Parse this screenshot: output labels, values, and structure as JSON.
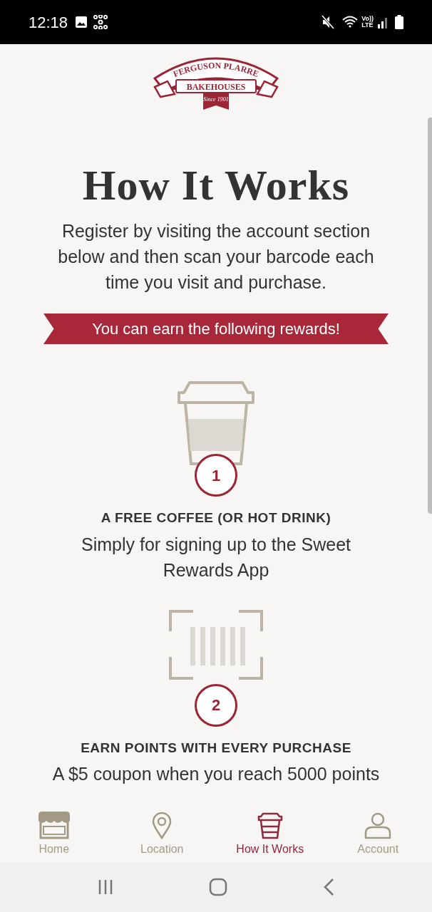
{
  "status_bar": {
    "time": "12:18",
    "volte": "Vo))",
    "network_type": "LTE"
  },
  "logo": {
    "top": "FERGUSON PLARRE",
    "middle": "BAKEHOUSES",
    "bottom": "Since 1901"
  },
  "title": "How It Works",
  "intro": "Register by visiting the account section below and then scan your barcode each time you visit and purchase.",
  "banner": "You can earn the following rewards!",
  "rewards": [
    {
      "kind": "cup",
      "number": "1",
      "heading": "A FREE COFFEE (OR HOT DRINK)",
      "text": "Simply for signing up to the Sweet Rewards App"
    },
    {
      "kind": "barcode",
      "number": "2",
      "heading": "EARN POINTS WITH EVERY PURCHASE",
      "text": "A $5 coupon when you reach 5000 points"
    }
  ],
  "tabs": [
    {
      "kind": "home",
      "label": "Home",
      "selected": false
    },
    {
      "kind": "location",
      "label": "Location",
      "selected": false
    },
    {
      "kind": "cup",
      "label": "How It Works",
      "selected": true
    },
    {
      "kind": "account",
      "label": "Account",
      "selected": false
    }
  ]
}
